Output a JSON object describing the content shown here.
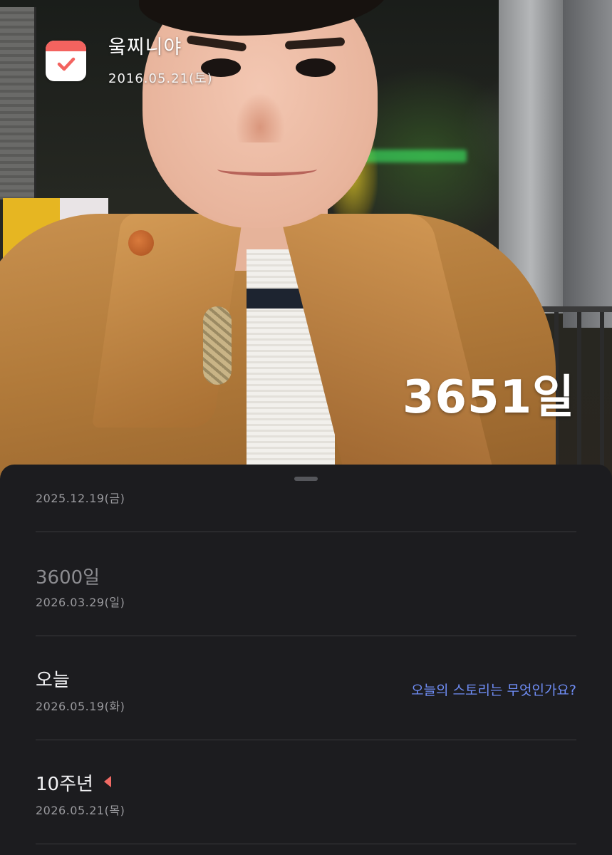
{
  "header": {
    "title": "웈찌니야",
    "start_date": "2016.05.21(토)",
    "day_count": "3651일"
  },
  "milestones": [
    {
      "label": "",
      "date": "2025.12.19(금)"
    },
    {
      "label": "3600일",
      "date": "2026.03.29(일)"
    },
    {
      "label": "오늘",
      "date": "2026.05.19(화)",
      "action": "오늘의 스토리는 무엇인가요?"
    },
    {
      "label": "10주년",
      "date": "2026.05.21(목)"
    }
  ],
  "colors": {
    "accent": "#f3635f",
    "link": "#6f8df5",
    "sheet_background": "#1c1c1f"
  },
  "icons": {
    "app_badge": "calendar-check-icon",
    "milestone_marker": "flag-icon"
  }
}
